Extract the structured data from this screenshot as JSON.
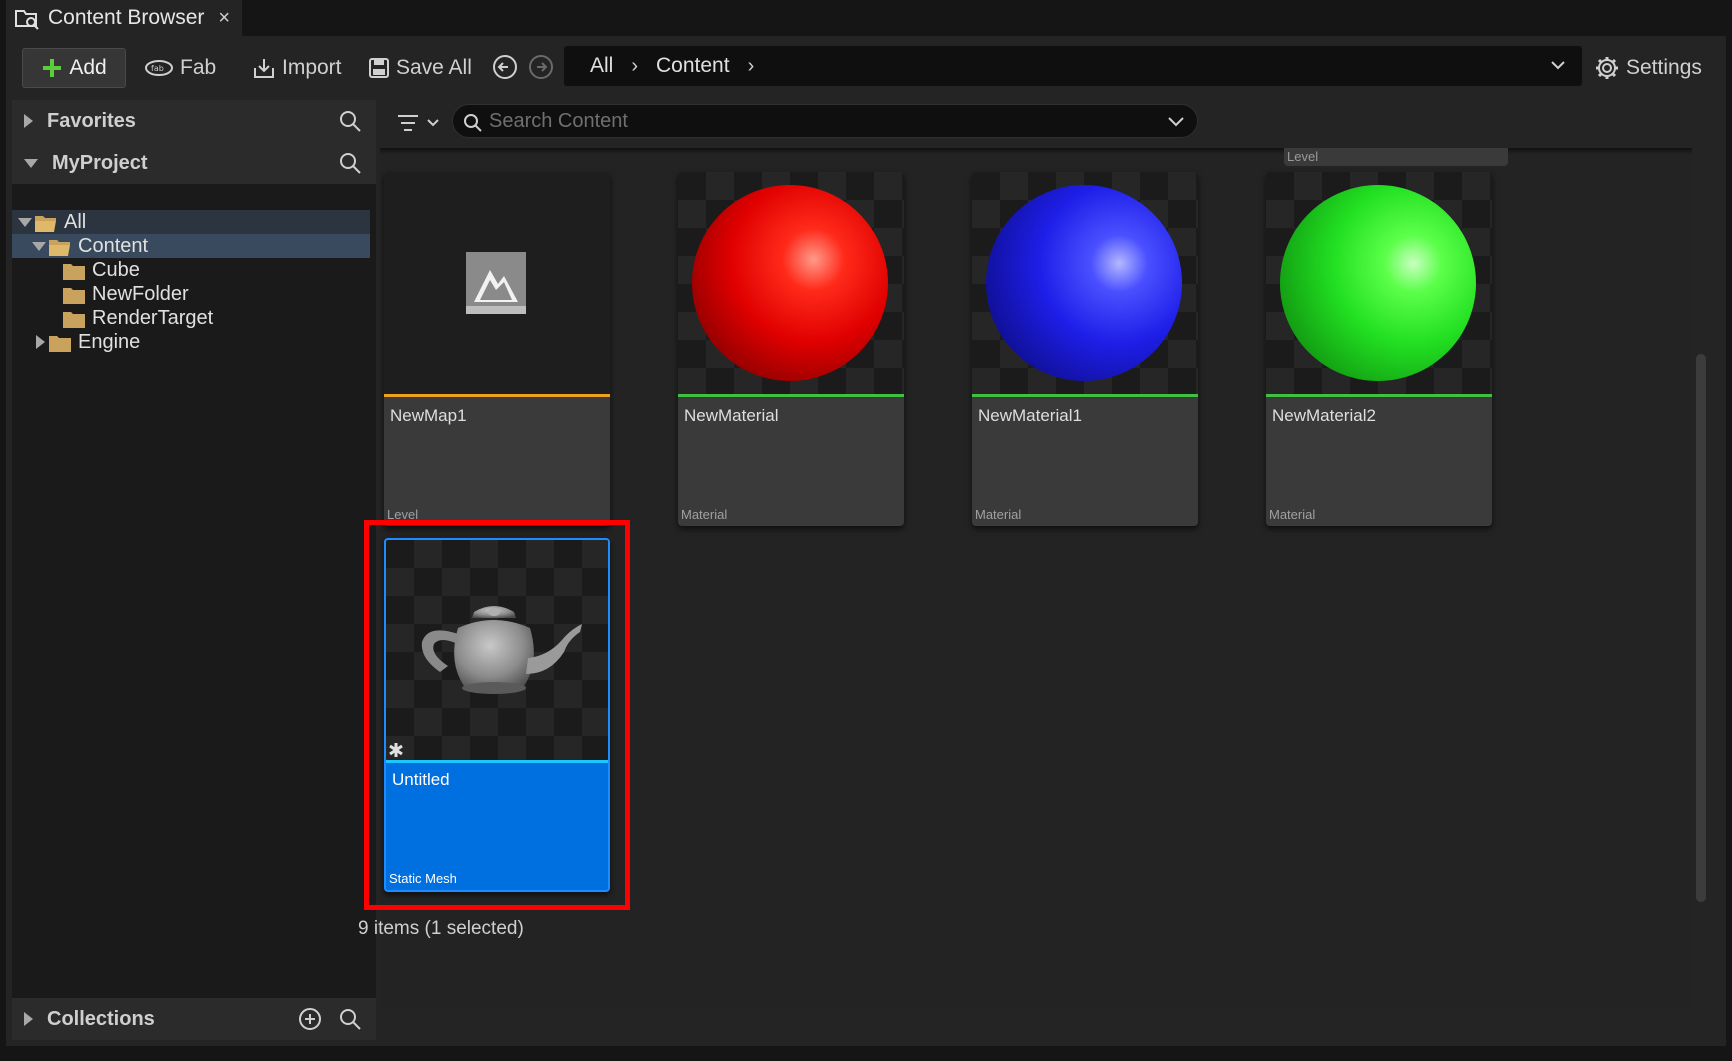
{
  "window": {
    "tab_title": "Content Browser",
    "close_glyph": "×"
  },
  "toolbar": {
    "add_label": "Add",
    "fab_label": "Fab",
    "import_label": "Import",
    "save_all_label": "Save All",
    "settings_label": "Settings"
  },
  "breadcrumb": {
    "items": [
      "All",
      "Content"
    ],
    "separator": "›"
  },
  "sidebar": {
    "favorites_label": "Favorites",
    "project_label": "MyProject",
    "collections_label": "Collections",
    "tree": [
      {
        "label": "All",
        "expanded": true
      },
      {
        "label": "Content",
        "expanded": true,
        "selected": true
      },
      {
        "label": "Cube"
      },
      {
        "label": "NewFolder"
      },
      {
        "label": "RenderTarget"
      },
      {
        "label": "Engine",
        "expanded": false
      }
    ]
  },
  "search": {
    "placeholder": "Search Content",
    "value": ""
  },
  "assets": [
    {
      "name": "NewMap1",
      "type": "Level",
      "bar_color": "#f0a020"
    },
    {
      "name": "NewMaterial",
      "type": "Material",
      "bar_color": "#40c040",
      "sphere_color": "red"
    },
    {
      "name": "NewMaterial1",
      "type": "Material",
      "bar_color": "#40c040",
      "sphere_color": "blue"
    },
    {
      "name": "NewMaterial2",
      "type": "Material",
      "bar_color": "#40c040",
      "sphere_color": "green"
    },
    {
      "name": "Untitled",
      "type": "Static Mesh",
      "bar_color": "#19c8ff",
      "selected": true
    }
  ],
  "partial_tile_type": "Level",
  "status": {
    "text": "9 items (1 selected)"
  },
  "colors": {
    "selection_blue": "#0070e0",
    "highlight_red": "#ff0000",
    "folder": "#c9a35e"
  }
}
